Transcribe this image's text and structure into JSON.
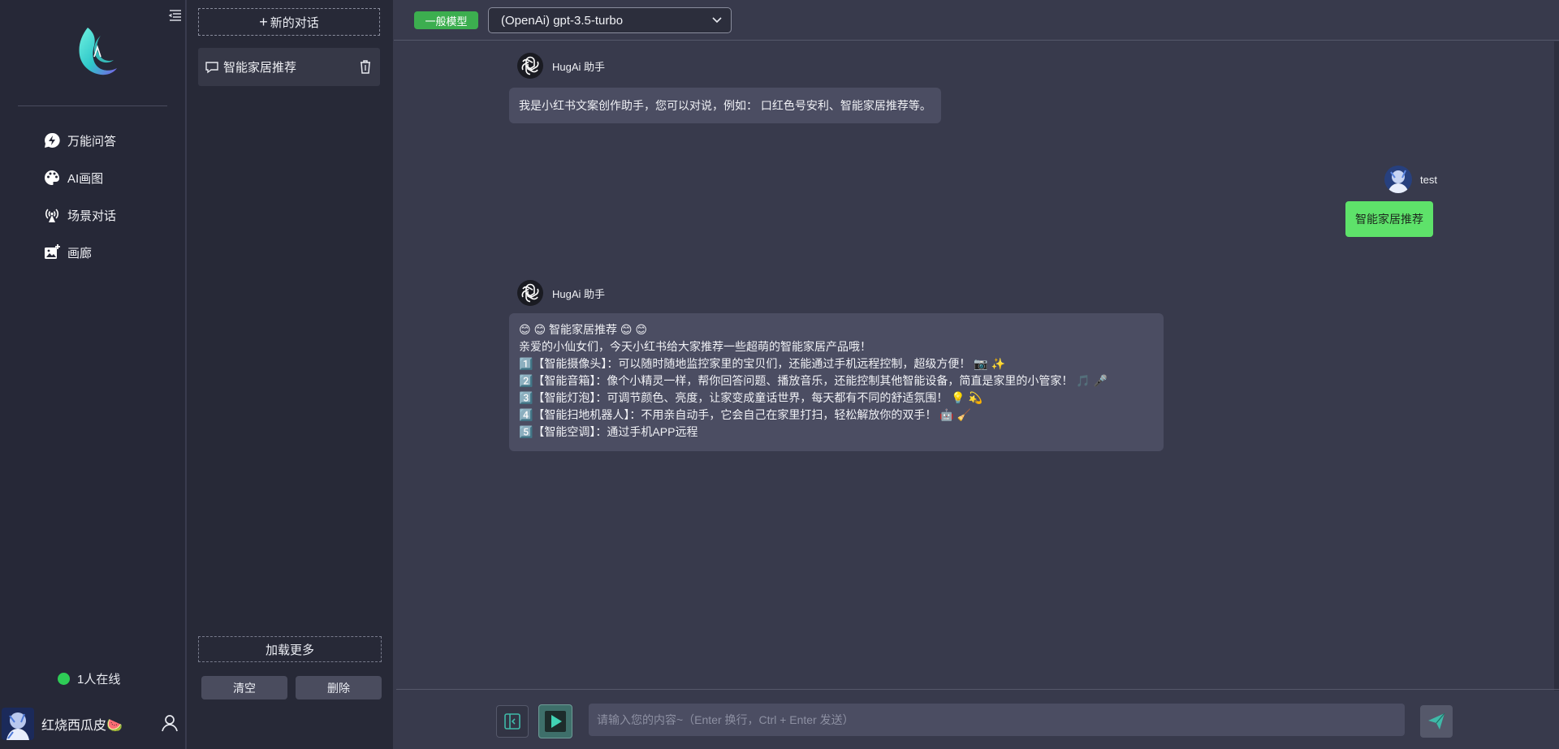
{
  "nav": {
    "items": [
      {
        "label": "万能问答",
        "icon": "lightning-chat-icon"
      },
      {
        "label": "AI画图",
        "icon": "palette-icon"
      },
      {
        "label": "场景对话",
        "icon": "broadcast-icon"
      },
      {
        "label": "画廊",
        "icon": "image-add-icon"
      }
    ],
    "online_text": "1人在线",
    "online_color": "#2ecc56",
    "user_name": "红烧西瓜皮🍉"
  },
  "chats": {
    "new_chat_label": "新的对话",
    "items": [
      {
        "label": "智能家居推荐"
      }
    ],
    "load_more_label": "加载更多",
    "clear_label": "清空",
    "delete_label": "删除"
  },
  "topbar": {
    "model_badge": "一般模型",
    "model_select_value": "(OpenAi) gpt-3.5-turbo"
  },
  "messages": {
    "bot_name": "HugAi 助手",
    "greeting": "我是小红书文案创作助手，您可以对说，例如： 口红色号安利、智能家居推荐等。",
    "user_name": "test",
    "user_message": "智能家居推荐",
    "reply_lines": [
      "😊 😊 智能家居推荐 😊 😊",
      "亲爱的小仙女们，今天小红书给大家推荐一些超萌的智能家居产品哦！",
      "1️⃣【智能摄像头】：可以随时随地监控家里的宝贝们，还能通过手机远程控制，超级方便！ 📷 ✨",
      "2️⃣【智能音箱】：像个小精灵一样，帮你回答问题、播放音乐，还能控制其他智能设备，简直是家里的小管家！ 🎵 🎤",
      "3️⃣【智能灯泡】：可调节颜色、亮度，让家变成童话世界，每天都有不同的舒适氛围！ 💡 💫",
      "4️⃣【智能扫地机器人】：不用亲自动手，它会自己在家里打扫，轻松解放你的双手！ 🤖 🧹",
      "5️⃣【智能空调】：通过手机APP远程"
    ]
  },
  "input": {
    "placeholder": "请输入您的内容~（Enter 换行，Ctrl + Enter 发送）"
  },
  "colors": {
    "accent_green": "#3cae4f",
    "user_bubble": "#5ee26a",
    "play_button": "#3e6f6a"
  }
}
